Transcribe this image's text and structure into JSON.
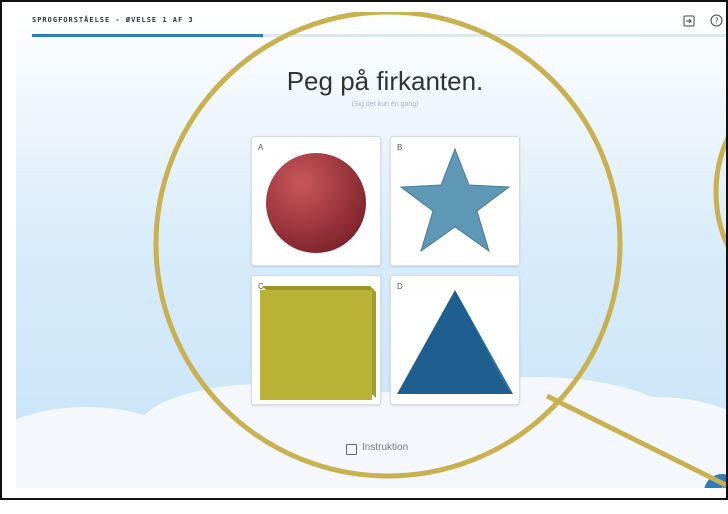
{
  "header": {
    "title": "SPROGFORSTÅELSE - ØVELSE 1 AF 3",
    "exit_icon": "exit-icon",
    "help_icon": "help-icon"
  },
  "progress": {
    "fraction": 0.33
  },
  "question": {
    "text": "Peg på firkanten.",
    "hint": "(Sig det kun én gang)"
  },
  "options": [
    {
      "letter": "A",
      "shape": "circle",
      "color": "#a83a3f"
    },
    {
      "letter": "B",
      "shape": "star",
      "color": "#5f97b6"
    },
    {
      "letter": "C",
      "shape": "square",
      "color": "#bab236"
    },
    {
      "letter": "D",
      "shape": "triangle",
      "color": "#1e5f8f"
    }
  ],
  "footer": {
    "instruction_text": "Instruktion",
    "next_icon": "arrow-right-icon"
  },
  "colors": {
    "accent": "#2f7bbf",
    "magnifier": "#c9b150",
    "cloud": "#f4f8fc"
  }
}
